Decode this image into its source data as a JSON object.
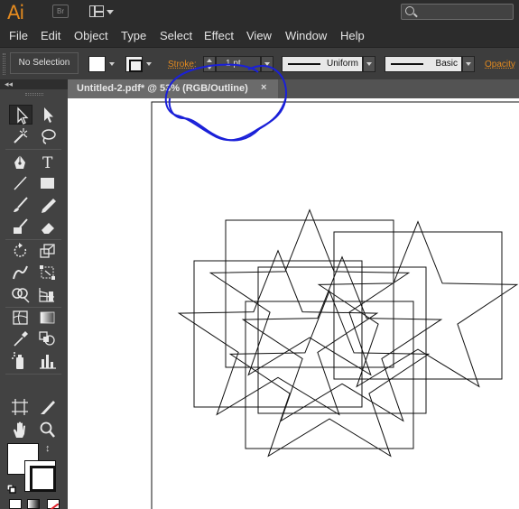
{
  "app": {
    "logo": "Ai",
    "bridge_label": "Br"
  },
  "menu": [
    "File",
    "Edit",
    "Object",
    "Type",
    "Select",
    "Effect",
    "View",
    "Window",
    "Help"
  ],
  "control": {
    "selection": "No Selection",
    "stroke_label": "Stroke:",
    "stroke_weight": "1 pt",
    "profile": "Uniform",
    "brush": "Basic",
    "opacity_label": "Opacity"
  },
  "toolbox": {
    "collapse": "◂◂"
  },
  "document": {
    "tab_title": "Untitled-2.pdf* @ 53% (RGB/Outline)",
    "tab_close": "×",
    "view_mode": "Outline",
    "zoom": "53%",
    "annotation_color": "#1a20d8"
  },
  "colors": {
    "brand_orange": "#e38a1f",
    "ui_dark": "#2c2c2c",
    "panel": "#424242"
  }
}
